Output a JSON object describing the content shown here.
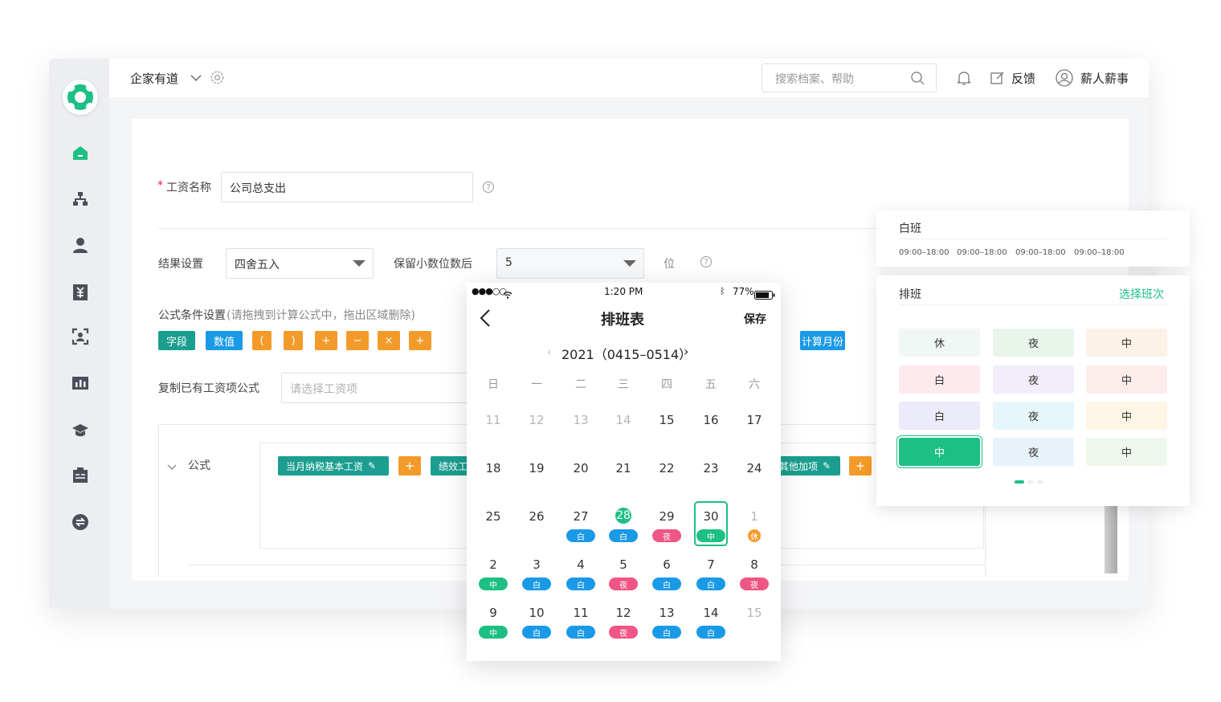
{
  "header": {
    "company": "企家有道",
    "search_placeholder": "搜索档案、帮助",
    "feedback": "反馈",
    "username": "薪人薪事"
  },
  "form": {
    "required_mark": "*",
    "salary_name_label": "工资名称",
    "salary_name_value": "公司总支出",
    "result_label": "结果设置",
    "result_value": "四舍五入",
    "decimals_label": "保留小数位数后",
    "decimals_value": "5",
    "decimals_unit": "位",
    "formula_cond_label": "公式条件设置",
    "formula_cond_hint": "(请拖拽到计算公式中，拖出区域删除)",
    "tags": [
      {
        "label": "字段",
        "color": "#1b9e8f"
      },
      {
        "label": "数值",
        "color": "#1a9ae6"
      },
      {
        "label": "(",
        "color": "#f39b2a"
      },
      {
        "label": ")",
        "color": "#f39b2a"
      },
      {
        "label": "+",
        "color": "#f39b2a"
      },
      {
        "label": "−",
        "color": "#f39b2a"
      },
      {
        "label": "×",
        "color": "#f39b2a"
      },
      {
        "label": "+",
        "color": "#f39b2a"
      }
    ],
    "tag_calc_month": "计算月份",
    "copy_label": "复制已有工资项公式",
    "copy_placeholder": "请选择工资项",
    "formula_label": "公式",
    "formula_items": [
      "当月纳税基本工资",
      "+",
      "绩效工",
      "其他加项",
      "+"
    ]
  },
  "phone": {
    "status_time": "1:20 PM",
    "battery": "77%",
    "title": "排班表",
    "save": "保存",
    "month_nav": "2021（0415–0514）",
    "weekdays": [
      "日",
      "一",
      "二",
      "三",
      "四",
      "五",
      "六"
    ],
    "weeks": [
      [
        {
          "d": "11",
          "g": true
        },
        {
          "d": "12",
          "g": true
        },
        {
          "d": "13",
          "g": true
        },
        {
          "d": "14",
          "g": true
        },
        {
          "d": "15"
        },
        {
          "d": "16"
        },
        {
          "d": "17"
        }
      ],
      [
        {
          "d": "18"
        },
        {
          "d": "19"
        },
        {
          "d": "20"
        },
        {
          "d": "21"
        },
        {
          "d": "22"
        },
        {
          "d": "23"
        },
        {
          "d": "24"
        }
      ],
      [
        {
          "d": "25"
        },
        {
          "d": "26"
        },
        {
          "d": "27",
          "s": "白"
        },
        {
          "d": "28",
          "s": "白",
          "today": true
        },
        {
          "d": "29",
          "s": "夜"
        },
        {
          "d": "30",
          "s": "中",
          "selected": true
        },
        {
          "d": "1",
          "s": "休",
          "g": true
        }
      ],
      [
        {
          "d": "2",
          "s": "中"
        },
        {
          "d": "3",
          "s": "白"
        },
        {
          "d": "4",
          "s": "白"
        },
        {
          "d": "5",
          "s": "夜"
        },
        {
          "d": "6",
          "s": "白"
        },
        {
          "d": "7",
          "s": "白"
        },
        {
          "d": "8",
          "s": "夜"
        }
      ],
      [
        {
          "d": "9",
          "s": "中"
        },
        {
          "d": "10",
          "s": "白"
        },
        {
          "d": "11",
          "s": "白"
        },
        {
          "d": "12",
          "s": "夜"
        },
        {
          "d": "13",
          "s": "白"
        },
        {
          "d": "14",
          "s": "白"
        },
        {
          "d": "15",
          "g": true
        }
      ]
    ]
  },
  "shift_card": {
    "title": "白班",
    "times": [
      "09:00–18:00",
      "09:00–18:00",
      "09:00–18:00",
      "09:00–18:00"
    ]
  },
  "schedule_card": {
    "title": "排班",
    "action": "选择班次",
    "grid": [
      [
        {
          "t": "休",
          "bg": "#f1f7f5"
        },
        {
          "t": "夜",
          "bg": "#e9f5ea"
        },
        {
          "t": "中",
          "bg": "#fdf2e6"
        }
      ],
      [
        {
          "t": "白",
          "bg": "#fde9ee"
        },
        {
          "t": "夜",
          "bg": "#f3ecfb"
        },
        {
          "t": "中",
          "bg": "#fdecec"
        }
      ],
      [
        {
          "t": "白",
          "bg": "#ecebfb"
        },
        {
          "t": "夜",
          "bg": "#e6f7fb"
        },
        {
          "t": "中",
          "bg": "#fdf6e5"
        }
      ],
      [
        {
          "t": "中",
          "bg": "#1dbf85",
          "active": true
        },
        {
          "t": "夜",
          "bg": "#e7f2fb"
        },
        {
          "t": "中",
          "bg": "#eef7ec"
        }
      ]
    ]
  }
}
